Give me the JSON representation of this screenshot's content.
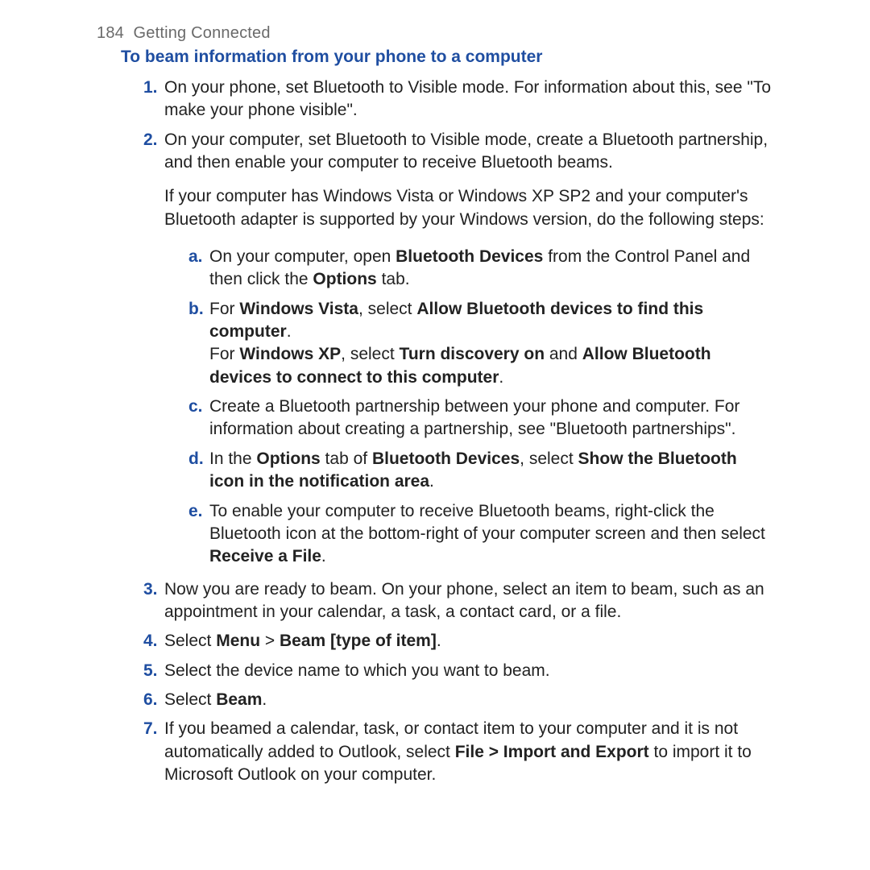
{
  "header": {
    "page_number": "184",
    "chapter": "Getting Connected"
  },
  "section_title": "To beam information from your phone to a computer",
  "steps": {
    "s1": {
      "num": "1.",
      "text": "On your phone, set Bluetooth to Visible mode. For information about this, see \"To make your phone visible\"."
    },
    "s2": {
      "num": "2.",
      "para1": "On your computer, set Bluetooth to Visible mode, create a Bluetooth partnership, and then enable your computer to receive Bluetooth beams.",
      "para2": "If your computer has Windows Vista or Windows XP SP2 and your computer's Bluetooth adapter is supported by your Windows version, do the following steps:",
      "a": {
        "alpha": "a.",
        "pre": "On your computer, open ",
        "b1": "Bluetooth Devices",
        "mid": " from the Control Panel and then click the ",
        "b2": "Options",
        "post": " tab."
      },
      "b": {
        "alpha": "b.",
        "l1_pre": "For ",
        "l1_b1": "Windows Vista",
        "l1_mid": ", select ",
        "l1_b2": "Allow Bluetooth devices to find this computer",
        "l1_post": ".",
        "l2_pre": "For ",
        "l2_b1": "Windows XP",
        "l2_mid1": ", select ",
        "l2_b2": "Turn discovery on",
        "l2_mid2": " and ",
        "l2_b3": "Allow Bluetooth devices to connect to this computer",
        "l2_post": "."
      },
      "c": {
        "alpha": "c.",
        "text": "Create a Bluetooth partnership between your phone and computer. For information about creating a partnership, see \"Bluetooth partnerships\"."
      },
      "d": {
        "alpha": "d.",
        "pre": "In the ",
        "b1": "Options",
        "mid1": " tab of ",
        "b2": "Bluetooth Devices",
        "mid2": ", select ",
        "b3": "Show the Bluetooth icon in the notification area",
        "post": "."
      },
      "e": {
        "alpha": "e.",
        "pre": "To enable your computer to receive Bluetooth beams, right-click the Bluetooth icon at the bottom-right of your computer screen and then select ",
        "b1": "Receive a File",
        "post": "."
      }
    },
    "s3": {
      "num": "3.",
      "text": "Now you are ready to beam. On your phone, select an item to beam, such as an appointment in your calendar, a task, a contact card, or a file."
    },
    "s4": {
      "num": "4.",
      "pre": "Select ",
      "b1": "Menu",
      "mid": " > ",
      "b2": "Beam [type of item]",
      "post": "."
    },
    "s5": {
      "num": "5.",
      "text": "Select the device name to which you want to beam."
    },
    "s6": {
      "num": "6.",
      "pre": "Select ",
      "b1": "Beam",
      "post": "."
    },
    "s7": {
      "num": "7.",
      "pre": "If you beamed a calendar, task, or contact item to your computer and it is not automatically added to Outlook, select ",
      "b1": "File > Import and Export",
      "post": " to import it to Microsoft Outlook on your computer."
    }
  }
}
